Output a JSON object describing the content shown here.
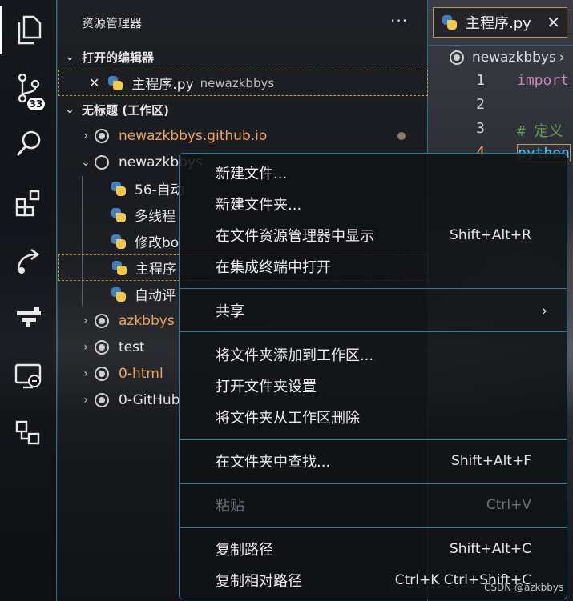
{
  "activity_bar": {
    "icons": [
      "explorer-icon",
      "source-control-icon",
      "search-icon",
      "extensions-icon",
      "remote-share-icon",
      "gitlens-icon",
      "remote-explorer-icon",
      "containers-icon"
    ],
    "source_control_badge": "33"
  },
  "sidebar": {
    "title": "资源管理器",
    "more": "···",
    "open_editors": {
      "header": "打开的编辑器",
      "items": [
        {
          "close": "✕",
          "name": "主程序.py",
          "folder": "newazkbbys"
        }
      ]
    },
    "workspace": {
      "header": "无标题 (工作区)",
      "folders": [
        {
          "name": "newazkbbys.github.io",
          "expanded": false
        },
        {
          "name": "newazkbbys",
          "expanded": true
        },
        {
          "name": "azkbbys",
          "expanded": false
        },
        {
          "name": "test",
          "expanded": false
        },
        {
          "name": "0-html",
          "expanded": false
        },
        {
          "name": "0-GitHub",
          "expanded": false
        }
      ],
      "files": [
        "56-自动",
        "多线程",
        "修改bo",
        "主程序",
        "自动评"
      ]
    }
  },
  "editor": {
    "tab": {
      "label": "主程序.py",
      "close": "✕"
    },
    "breadcrumb": "newazkbbys",
    "breadcrumb_sep": "›",
    "line_numbers": [
      "1",
      "2",
      "3",
      "4"
    ],
    "code_lines": [
      "import",
      "",
      "# 定义",
      "python"
    ]
  },
  "context_menu": {
    "groups": [
      [
        {
          "label": "新建文件...",
          "shortcut": ""
        },
        {
          "label": "新建文件夹...",
          "shortcut": ""
        },
        {
          "label": "在文件资源管理器中显示",
          "shortcut": "Shift+Alt+R"
        },
        {
          "label": "在集成终端中打开",
          "shortcut": ""
        }
      ],
      [
        {
          "label": "共享",
          "shortcut": "",
          "submenu": "›"
        }
      ],
      [
        {
          "label": "将文件夹添加到工作区...",
          "shortcut": ""
        },
        {
          "label": "打开文件夹设置",
          "shortcut": ""
        },
        {
          "label": "将文件夹从工作区删除",
          "shortcut": ""
        }
      ],
      [
        {
          "label": "在文件夹中查找...",
          "shortcut": "Shift+Alt+F"
        }
      ],
      [
        {
          "label": "粘贴",
          "shortcut": "Ctrl+V",
          "disabled": true
        }
      ],
      [
        {
          "label": "复制路径",
          "shortcut": "Shift+Alt+C"
        },
        {
          "label": "复制相对路径",
          "shortcut": "Ctrl+K Ctrl+Shift+C"
        }
      ]
    ]
  },
  "watermark": "CSDN @azkbbys",
  "colors": {
    "accent_border": "#2f7c9a",
    "selection_border": "#c09a55",
    "git_modified": "#f0a35e",
    "python_blue": "#3f7fc2",
    "python_yellow": "#f2c94a"
  }
}
